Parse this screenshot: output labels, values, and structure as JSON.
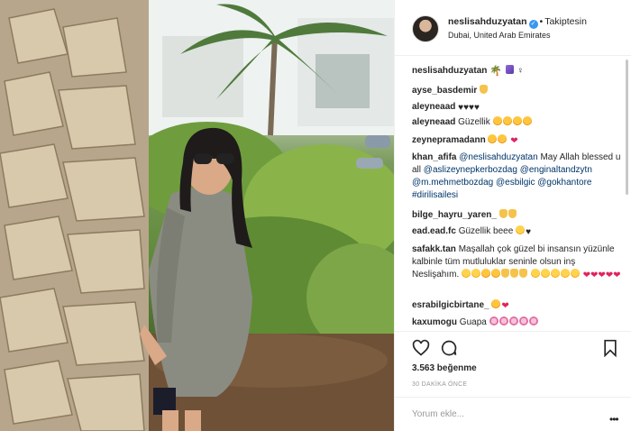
{
  "post": {
    "photo_alt": "",
    "header": {
      "username": "neslisahduzyatan",
      "verified_badge": "verified-badge",
      "separator": "•",
      "follow_status": "Takiptesin",
      "location": "Dubai, United Arab Emirates"
    },
    "comments": [
      {
        "user": "neslisahduzyatan",
        "text": "",
        "emojis": [
          "palm-tree",
          "misc",
          "female-sign"
        ]
      },
      {
        "user": "ayse_basdemir",
        "text": "",
        "emojis": [
          "thumbs-up"
        ]
      },
      {
        "user": "aleyneaad",
        "text": "",
        "hearts": "♥♥♥♥"
      },
      {
        "user": "aleyneaad",
        "text": "Güzellik",
        "emojis": [
          "heart-eyes",
          "heart-eyes",
          "heart-eyes",
          "heart-eyes"
        ]
      },
      {
        "user": "zeynepramadann",
        "text": "",
        "emojis": [
          "heart-eyes",
          "heart-eyes"
        ],
        "hearts": "❤"
      },
      {
        "user": "khan_afifa",
        "text_parts": [
          "@neslisahduzyatan",
          " May Allah blessed u all ",
          "@aslizeynepkerbozdag",
          " ",
          "@enginaltandzytn",
          " ",
          "@m.mehmetbozdag",
          " ",
          "@esbilgic",
          " ",
          "@gokhantore",
          " ",
          "#dirilisailesi"
        ]
      },
      {
        "user": "bilge_hayru_yaren_",
        "text": "",
        "emojis": [
          "thumbs-up",
          "thumbs-up"
        ]
      },
      {
        "user": "ead.ead.fc",
        "text": "Güzellik beee",
        "emojis": [
          "face"
        ],
        "hearts": "♥"
      },
      {
        "user": "safakk.tan",
        "text": "Maşallah çok güzel bi insansın yüzünle kalbinle tüm mutluluklar seninle olsun inş Neslişahım.",
        "emojis": [
          "face",
          "face",
          "heart-eyes",
          "heart-eyes",
          "thumbs-up",
          "thumbs-up",
          "thumbs-up",
          "face",
          "face",
          "face",
          "face",
          "face"
        ],
        "hearts": "❤❤❤❤❤"
      },
      {
        "user": "esrabilgicbirtane_",
        "text": "",
        "emojis": [
          "heart-eyes"
        ],
        "hearts": "❤"
      },
      {
        "user": "kaxumogu",
        "text": "Guapa",
        "emojis": [
          "flower",
          "flower",
          "flower",
          "flower",
          "flower"
        ]
      }
    ],
    "actions": {
      "like_icon": "heart-outline-icon",
      "comment_icon": "comment-icon",
      "save_icon": "bookmark-icon"
    },
    "likes_text": "3.563 beğenme",
    "timestamp": "30 DAKİKA ÖNCE",
    "add_comment_placeholder": "Yorum ekle...",
    "more_options": "•••"
  }
}
